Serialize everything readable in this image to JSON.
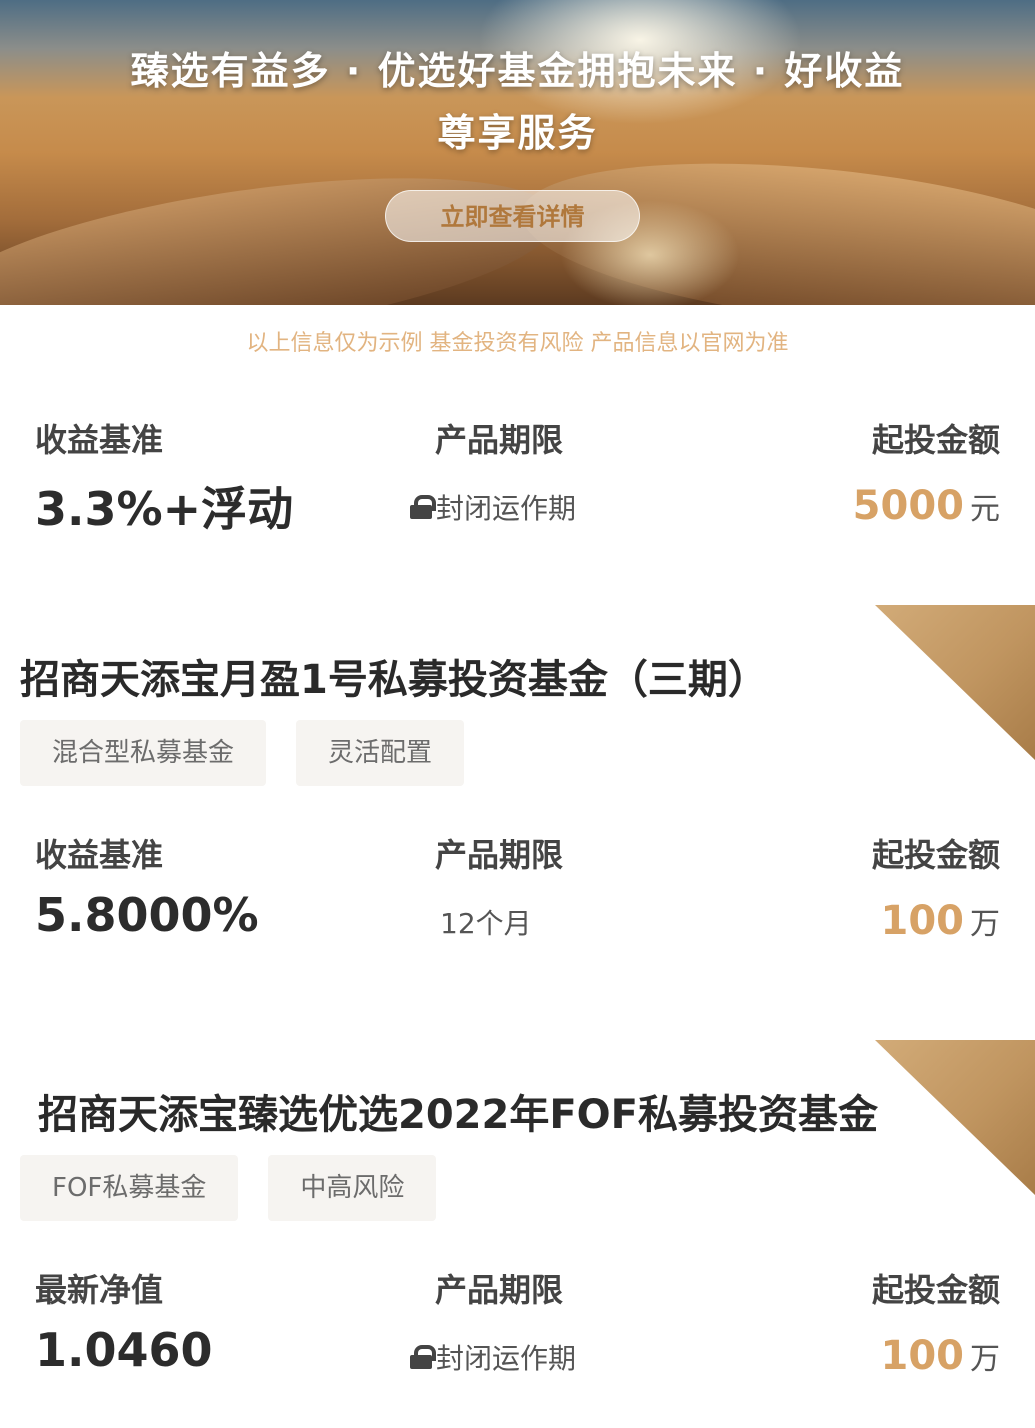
{
  "banner": {
    "title_line1": "臻选有益多 · 优选好基金拥抱未来 · 好收益",
    "title_line2": "尊享服务",
    "button_label": "立即查看详情"
  },
  "notice": "以上信息仅为示例 基金投资有风险 产品信息以官网为准",
  "cards": [
    {
      "title": "",
      "tags": [],
      "metrics": {
        "left_label": "收益基准",
        "left_value": "3.3%+浮动",
        "center_label": "产品期限",
        "center_value": "封闭运作期",
        "right_label": "起投金额",
        "right_amount": "5000",
        "right_unit": "元"
      }
    },
    {
      "title": "招商天添宝月盈1号私募投资基金（三期）",
      "tags": [
        "混合型私募基金",
        "灵活配置"
      ],
      "metrics": {
        "left_label": "收益基准",
        "left_value": "5.8000%",
        "center_label": "产品期限",
        "center_value": "12个月",
        "right_label": "起投金额",
        "right_amount": "100",
        "right_unit": "万"
      }
    },
    {
      "title": "招商天添宝臻选优选2022年FOF私募投资基金",
      "tags": [
        "FOF私募基金",
        "中高风险"
      ],
      "metrics": {
        "left_label": "最新净值",
        "left_value": "1.0460",
        "center_label": "产品期限",
        "center_value": "封闭运作期",
        "right_label": "起投金额",
        "right_amount": "100",
        "right_unit": "万"
      }
    }
  ],
  "colors": {
    "accent_gold": "#d7a266",
    "notice_gold": "#e2b481",
    "tag_bg": "#f6f4f1"
  }
}
